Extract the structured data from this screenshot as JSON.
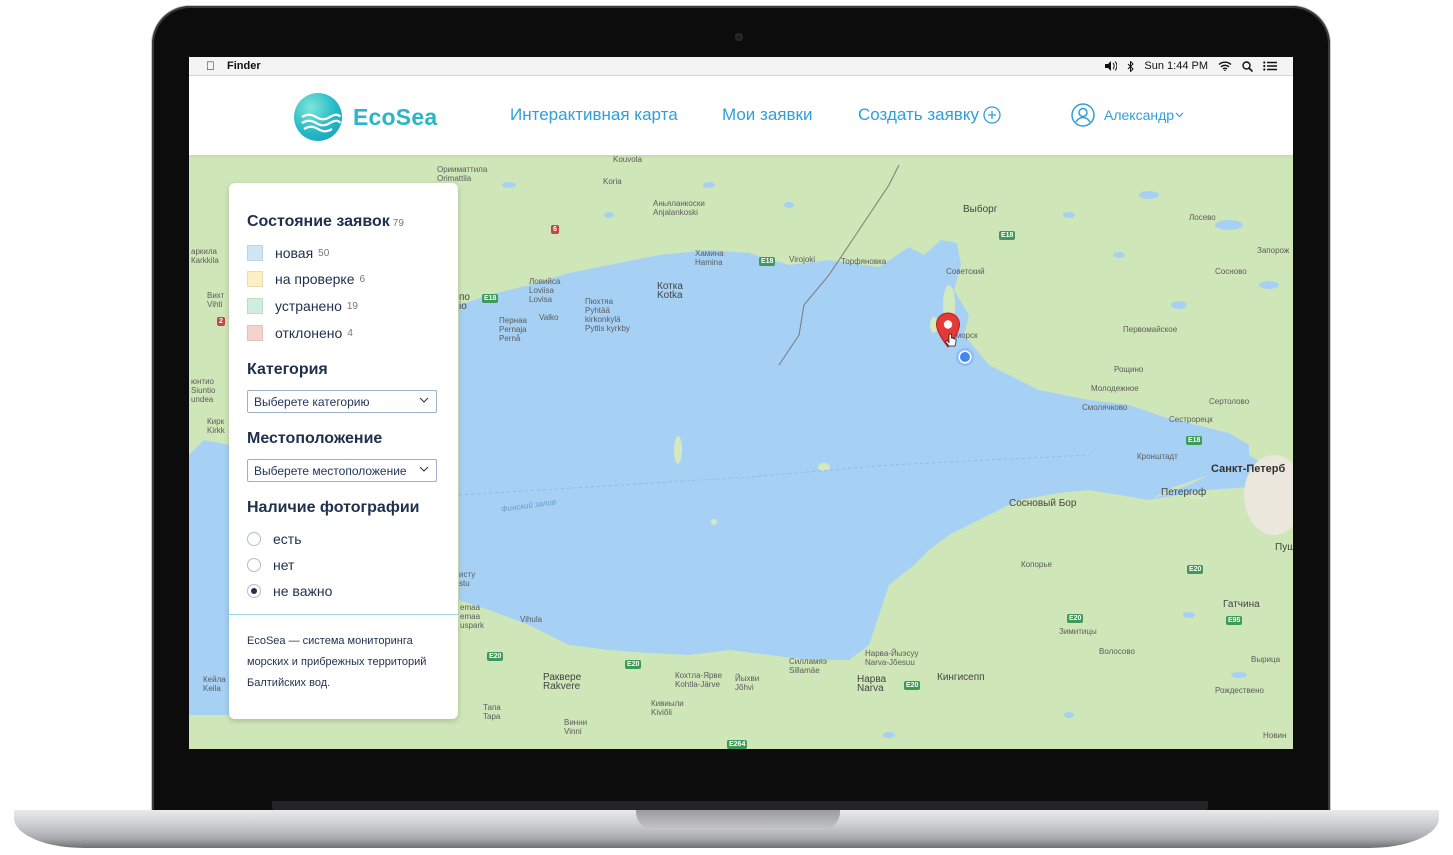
{
  "menubar": {
    "app": "Finder",
    "clock": "Sun 1:44 PM"
  },
  "header": {
    "brand": "EcoSea",
    "nav": {
      "map": "Интерактивная карта",
      "my_requests": "Мои заявки",
      "create_request": "Создать заявку"
    },
    "user": "Александр"
  },
  "filters": {
    "status_title": "Состояние заявок",
    "status_total": "79",
    "statuses": [
      {
        "label": "новая",
        "count": "50",
        "color": "#cfe6f6"
      },
      {
        "label": "на проверке",
        "count": "6",
        "color": "#fbefc4"
      },
      {
        "label": "устранено",
        "count": "19",
        "color": "#cfeede"
      },
      {
        "label": "отклонено",
        "count": "4",
        "color": "#f6d2cf"
      }
    ],
    "category_title": "Категория",
    "category_placeholder": "Выберете категорию",
    "location_title": "Местоположение",
    "location_placeholder": "Выберете местоположение",
    "photo_title": "Наличие фотографии",
    "photo_options": [
      {
        "label": "есть",
        "selected": false
      },
      {
        "label": "нет",
        "selected": false
      },
      {
        "label": "не важно",
        "selected": true
      }
    ],
    "about": "EcoSea — система мониторинга морских и прибрежных территорий Балтийских вод."
  },
  "map": {
    "labels": {
      "kouvola": "Kouvola",
      "koria": "Koria",
      "orimattila": "Орииматтила\nOrimattila",
      "anjalankoski": "Аньяланкоски\nAnjalankoski",
      "vyborg": "Выборг",
      "hamina": "Хамина\nHamina",
      "virojoki": "Virojoki",
      "torfyanovka": "Торфяновка",
      "sovetsky": "Советский",
      "losevo": "Лосево",
      "zaporozh": "Запорож",
      "sosnovo": "Сосново",
      "loviisa": "Ловийса\nLoviisa\nLovisa",
      "kotka": "Котка\nKotka",
      "pyhtaa": "Пюхтяа\nPyhtää\nkirkonkylä\nPyttis kyrkby",
      "valko": "Valko",
      "pernaja": "Пернаа\nPernaja\nPernå",
      "primorsk": "Приморск",
      "pervomaiskoe": "Первомайское",
      "roshchino": "Рощино",
      "molodezhnoe": "Молодежное",
      "smolyachkovo": "Смолячково",
      "sertolovo": "Сертолово",
      "sestroretsk": "Сестрорецк",
      "kronshtadt": "Кронштадт",
      "spb": "Санкт-Петерб",
      "peterhof": "Петергоф",
      "sosnovy_bor": "Сосновый Бор",
      "pushkin": "Пушки",
      "koporye": "Копорье",
      "gatchina": "Гатчина",
      "zimitsy": "Зимитицы",
      "volosovo": "Волосово",
      "vyritsa": "Вырица",
      "rozhdestveno": "Рождествено",
      "kingisepp": "Кингисепп",
      "narva_joesuu": "Нарва-Йыэсуу\nNarva-Jõesuu",
      "narva": "Нарва\nNarva",
      "sillamae": "Силламяэ\nSillamäe",
      "kohtla": "Кохтла-Ярве\nKohtla-Järve",
      "johvi": "Йыхви\nJõhvi",
      "kiviyli": "Кивиыли\nKiviõli",
      "rakvere": "Раквере\nRakvere",
      "vinni": "Винни\nVinni",
      "tapa": "Тапа\nTapa",
      "vihula": "Vihula",
      "kemaa": "emaa\nemaa\nuspark",
      "keila": "Кейла\nKeila",
      "finnish_gulf": "Финский залив",
      "novin": "Новин",
      "arkkila": "аркила\nКarkkila",
      "vihti": "Вихт\nVihti",
      "kirkk": "Кирк\nKirkk",
      "siuntio": "юнтио\nSiuntio\nundea",
      "isty": "исту\nstu",
      "po": "по\nio"
    },
    "roads": {
      "e18a": "E18",
      "e18b": "E18",
      "e18c": "E18",
      "e18d": "E18",
      "e20a": "E20",
      "e20b": "E20",
      "e20c": "E20",
      "e20d": "E20",
      "e20e": "E20",
      "e95": "E95",
      "e264": "E264",
      "n6": "6",
      "n2": "2"
    }
  }
}
